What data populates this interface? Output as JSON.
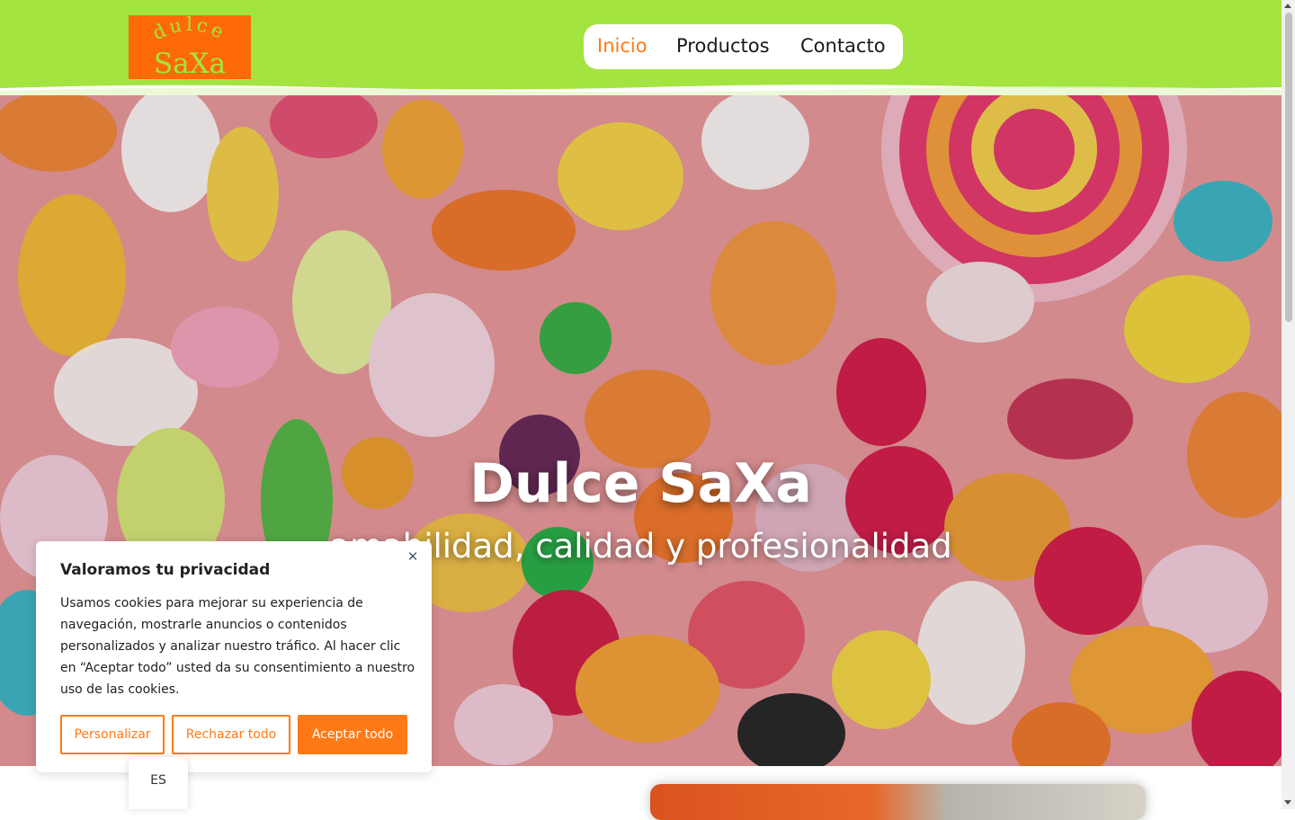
{
  "header": {
    "logo": {
      "line1": "dulce",
      "line2": "SaXa",
      "background": "#ff6a08",
      "text_color": "#a3e441"
    },
    "nav": [
      {
        "label": "Inicio",
        "active": true
      },
      {
        "label": "Productos",
        "active": false
      },
      {
        "label": "Contacto",
        "active": false
      }
    ],
    "background": "#a3e441",
    "accent": "#ff7a17"
  },
  "hero": {
    "title": "Dulce SaXa",
    "subtitle": "amabilidad, calidad y profesionalidad"
  },
  "cookie_banner": {
    "title": "Valoramos tu privacidad",
    "text": "Usamos cookies para mejorar su experiencia de navegación, mostrarle anuncios o contenidos personalizados y analizar nuestro tráfico. Al hacer clic en “Aceptar todo” usted da su consentimiento a nuestro uso de las cookies.",
    "close_icon": "close-icon",
    "buttons": {
      "customize": "Personalizar",
      "reject": "Rechazar todo",
      "accept": "Aceptar todo"
    }
  },
  "language_switcher": {
    "label": "ES"
  }
}
